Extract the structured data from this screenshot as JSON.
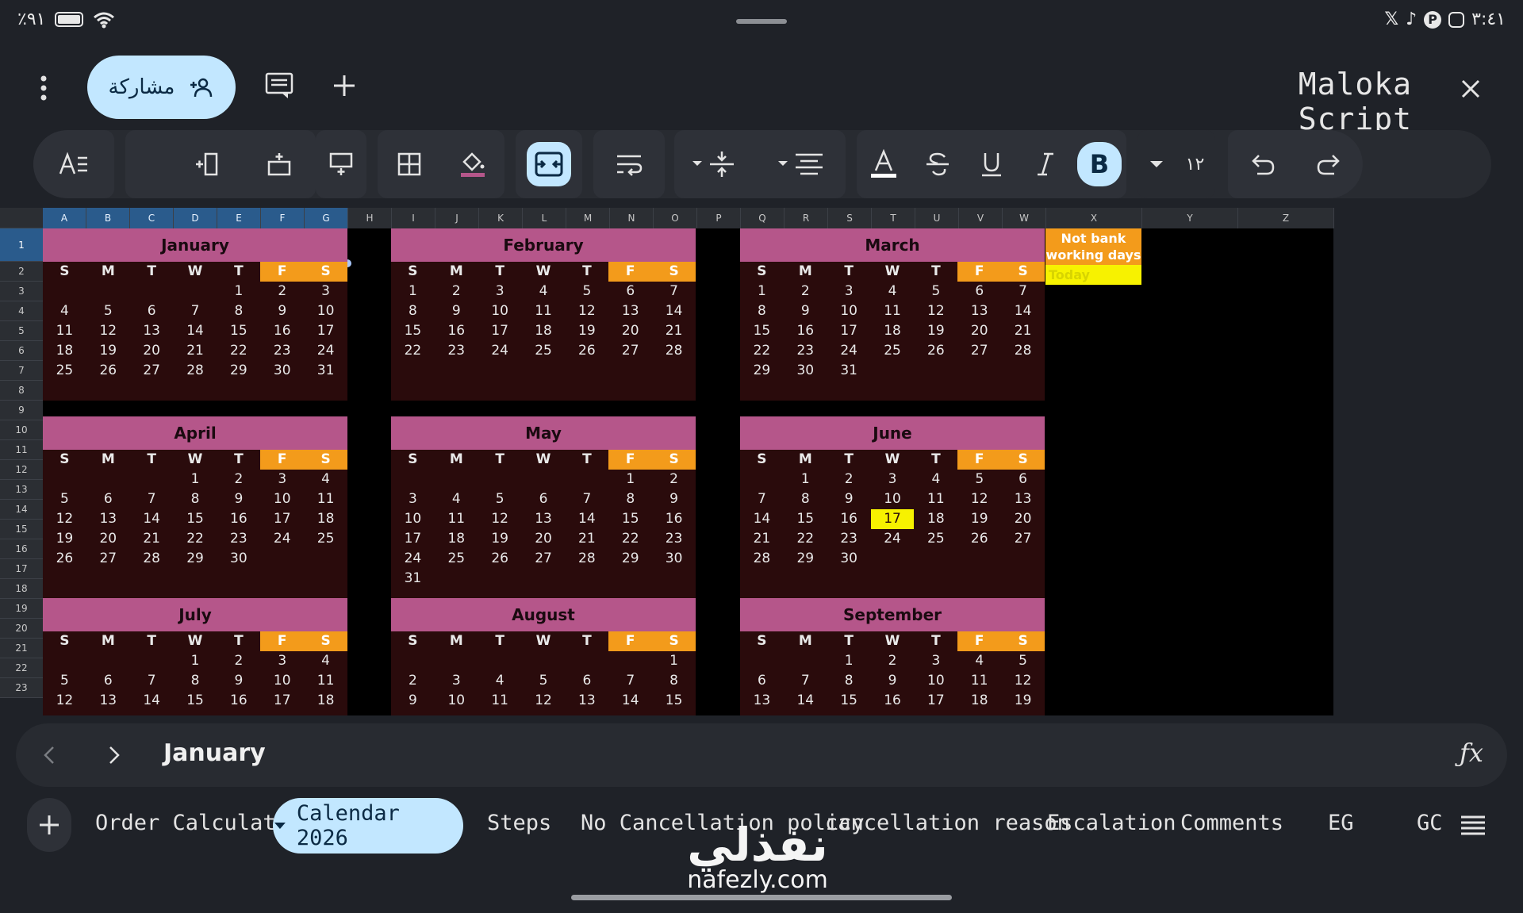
{
  "status_bar": {
    "battery": "٪۹١",
    "time": "٣:٤١",
    "icons": [
      "x-icon",
      "tiktok-icon",
      "pinterest-icon",
      "instagram-icon"
    ]
  },
  "topbar": {
    "share_label": "مشاركة",
    "title": "Maloka Script"
  },
  "toolbar": {
    "font_size": "١٢"
  },
  "columns": [
    "A",
    "B",
    "C",
    "D",
    "E",
    "F",
    "G",
    "H",
    "I",
    "J",
    "K",
    "L",
    "M",
    "N",
    "O",
    "P",
    "Q",
    "R",
    "S",
    "T",
    "U",
    "V",
    "W",
    "X",
    "Y",
    "Z"
  ],
  "rows": [
    "1",
    "2",
    "3",
    "4",
    "5",
    "6",
    "7",
    "8",
    "9",
    "10",
    "11",
    "12",
    "13",
    "14",
    "15",
    "16",
    "17",
    "18",
    "19",
    "20",
    "21",
    "22",
    "23"
  ],
  "weekdays": [
    "S",
    "M",
    "T",
    "W",
    "T",
    "F",
    "S"
  ],
  "legend": {
    "not_bank_line1": "Not bank",
    "not_bank_line2": "working days",
    "today": "Today"
  },
  "months": [
    {
      "name": "January",
      "rows": [
        [
          "",
          "",
          "",
          "",
          "1",
          "2",
          "3"
        ],
        [
          "4",
          "5",
          "6",
          "7",
          "8",
          "9",
          "10"
        ],
        [
          "11",
          "12",
          "13",
          "14",
          "15",
          "16",
          "17"
        ],
        [
          "18",
          "19",
          "20",
          "21",
          "22",
          "23",
          "24"
        ],
        [
          "25",
          "26",
          "27",
          "28",
          "29",
          "30",
          "31"
        ]
      ]
    },
    {
      "name": "February",
      "rows": [
        [
          "1",
          "2",
          "3",
          "4",
          "5",
          "6",
          "7"
        ],
        [
          "8",
          "9",
          "10",
          "11",
          "12",
          "13",
          "14"
        ],
        [
          "15",
          "16",
          "17",
          "18",
          "19",
          "20",
          "21"
        ],
        [
          "22",
          "23",
          "24",
          "25",
          "26",
          "27",
          "28"
        ]
      ]
    },
    {
      "name": "March",
      "rows": [
        [
          "1",
          "2",
          "3",
          "4",
          "5",
          "6",
          "7"
        ],
        [
          "8",
          "9",
          "10",
          "11",
          "12",
          "13",
          "14"
        ],
        [
          "15",
          "16",
          "17",
          "18",
          "19",
          "20",
          "21"
        ],
        [
          "22",
          "23",
          "24",
          "25",
          "26",
          "27",
          "28"
        ],
        [
          "29",
          "30",
          "31",
          "",
          "",
          "",
          ""
        ]
      ]
    },
    {
      "name": "April",
      "rows": [
        [
          "",
          "",
          "",
          "1",
          "2",
          "3",
          "4"
        ],
        [
          "5",
          "6",
          "7",
          "8",
          "9",
          "10",
          "11"
        ],
        [
          "12",
          "13",
          "14",
          "15",
          "16",
          "17",
          "18"
        ],
        [
          "19",
          "20",
          "21",
          "22",
          "23",
          "24",
          "25"
        ],
        [
          "26",
          "27",
          "28",
          "29",
          "30",
          "",
          ""
        ]
      ]
    },
    {
      "name": "May",
      "rows": [
        [
          "",
          "",
          "",
          "",
          "",
          "1",
          "2"
        ],
        [
          "3",
          "4",
          "5",
          "6",
          "7",
          "8",
          "9"
        ],
        [
          "10",
          "11",
          "12",
          "13",
          "14",
          "15",
          "16"
        ],
        [
          "17",
          "18",
          "19",
          "20",
          "21",
          "22",
          "23"
        ],
        [
          "24",
          "25",
          "26",
          "27",
          "28",
          "29",
          "30"
        ],
        [
          "31",
          "",
          "",
          "",
          "",
          "",
          ""
        ]
      ]
    },
    {
      "name": "June",
      "rows": [
        [
          "",
          "1",
          "2",
          "3",
          "4",
          "5",
          "6"
        ],
        [
          "7",
          "8",
          "9",
          "10",
          "11",
          "12",
          "13"
        ],
        [
          "14",
          "15",
          "16",
          "17",
          "18",
          "19",
          "20"
        ],
        [
          "21",
          "22",
          "23",
          "24",
          "25",
          "26",
          "27"
        ],
        [
          "28",
          "29",
          "30",
          "",
          "",
          "",
          ""
        ]
      ],
      "today": "17"
    },
    {
      "name": "July",
      "rows": [
        [
          "",
          "",
          "",
          "1",
          "2",
          "3",
          "4"
        ],
        [
          "5",
          "6",
          "7",
          "8",
          "9",
          "10",
          "11"
        ],
        [
          "12",
          "13",
          "14",
          "15",
          "16",
          "17",
          "18"
        ]
      ]
    },
    {
      "name": "August",
      "rows": [
        [
          "",
          "",
          "",
          "",
          "",
          "",
          "1"
        ],
        [
          "2",
          "3",
          "4",
          "5",
          "6",
          "7",
          "8"
        ],
        [
          "9",
          "10",
          "11",
          "12",
          "13",
          "14",
          "15"
        ]
      ]
    },
    {
      "name": "September",
      "rows": [
        [
          "",
          "",
          "1",
          "2",
          "3",
          "4",
          "5"
        ],
        [
          "6",
          "7",
          "8",
          "9",
          "10",
          "11",
          "12"
        ],
        [
          "13",
          "14",
          "15",
          "16",
          "17",
          "18",
          "19"
        ]
      ]
    }
  ],
  "formula_bar": {
    "value": "January"
  },
  "sheet_tabs": {
    "items": [
      "Order Calculator",
      "Calendar 2026",
      "Steps",
      "No Cancellation policy",
      "cancellation reason",
      "Escalation",
      "Comments",
      "EG",
      "GC"
    ],
    "active": "Calendar 2026"
  },
  "watermark": {
    "arabic": "نفذلي",
    "url": "nafezly.com"
  }
}
